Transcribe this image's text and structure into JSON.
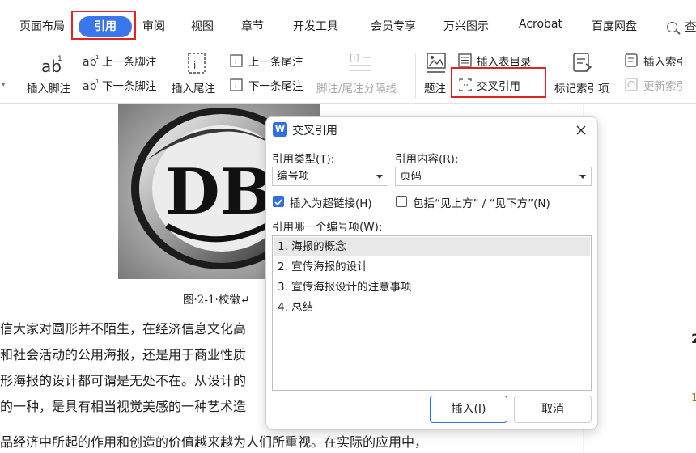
{
  "tabs": [
    {
      "label": "页面布局",
      "active": false
    },
    {
      "label": "引用",
      "active": true
    },
    {
      "label": "审阅",
      "active": false
    },
    {
      "label": "视图",
      "active": false
    },
    {
      "label": "章节",
      "active": false
    },
    {
      "label": "开发工具",
      "active": false
    },
    {
      "label": "会员专享",
      "active": false
    },
    {
      "label": "万兴图示",
      "active": false
    },
    {
      "label": "Acrobat",
      "active": false
    },
    {
      "label": "百度网盘",
      "active": false
    }
  ],
  "search_label": "查",
  "ribbon": {
    "insert_footnote": "插入脚注",
    "prev_footnote": "上一条脚注",
    "next_footnote": "下一条脚注",
    "insert_endnote": "插入尾注",
    "prev_endnote": "上一条尾注",
    "next_endnote": "下一条尾注",
    "footnote_separator": "脚注/尾注分隔线",
    "caption": "题注",
    "insert_table_of_figures": "插入表目录",
    "cross_reference": "交叉引用",
    "mark_index_entry": "标记索引项",
    "insert_index": "插入索引",
    "update_index": "更新索引"
  },
  "document": {
    "figure_caption": "图·2-1·校徽↵",
    "paragraph_lines": [
      "信大家对圆形并不陌生，在经济信息文化高",
      "和社会活动的公用海报，还是用于商业性质",
      "形海报的设计都可谓是无处不在。从设计的",
      "的一种，是具有相当视觉美感的一种艺术造",
      "品经济中所起的作用和创造的价值越来越为人们所重视。在实际的应用中，"
    ],
    "side_numbers": [
      "2",
      "1"
    ]
  },
  "dialog": {
    "title": "交叉引用",
    "ref_type_label": "引用类型(T):",
    "ref_type_value": "编号项",
    "ref_content_label": "引用内容(R):",
    "ref_content_value": "页码",
    "insert_hyperlink_label": "插入为超链接(H)",
    "insert_hyperlink_checked": true,
    "include_above_below_label": "包括“见上方” / “见下方”(N)",
    "include_above_below_checked": false,
    "which_item_label": "引用哪一个编号项(W):",
    "items": [
      "1. 海报的概念",
      "2. 宣传海报的设计",
      "3. 宣传海报设计的注意事项",
      "4. 总结"
    ],
    "selected_index": 0,
    "insert_button": "插入(I)",
    "cancel_button": "取消"
  },
  "colors": {
    "accent": "#3a76ec",
    "highlight_box": "#e02424"
  }
}
